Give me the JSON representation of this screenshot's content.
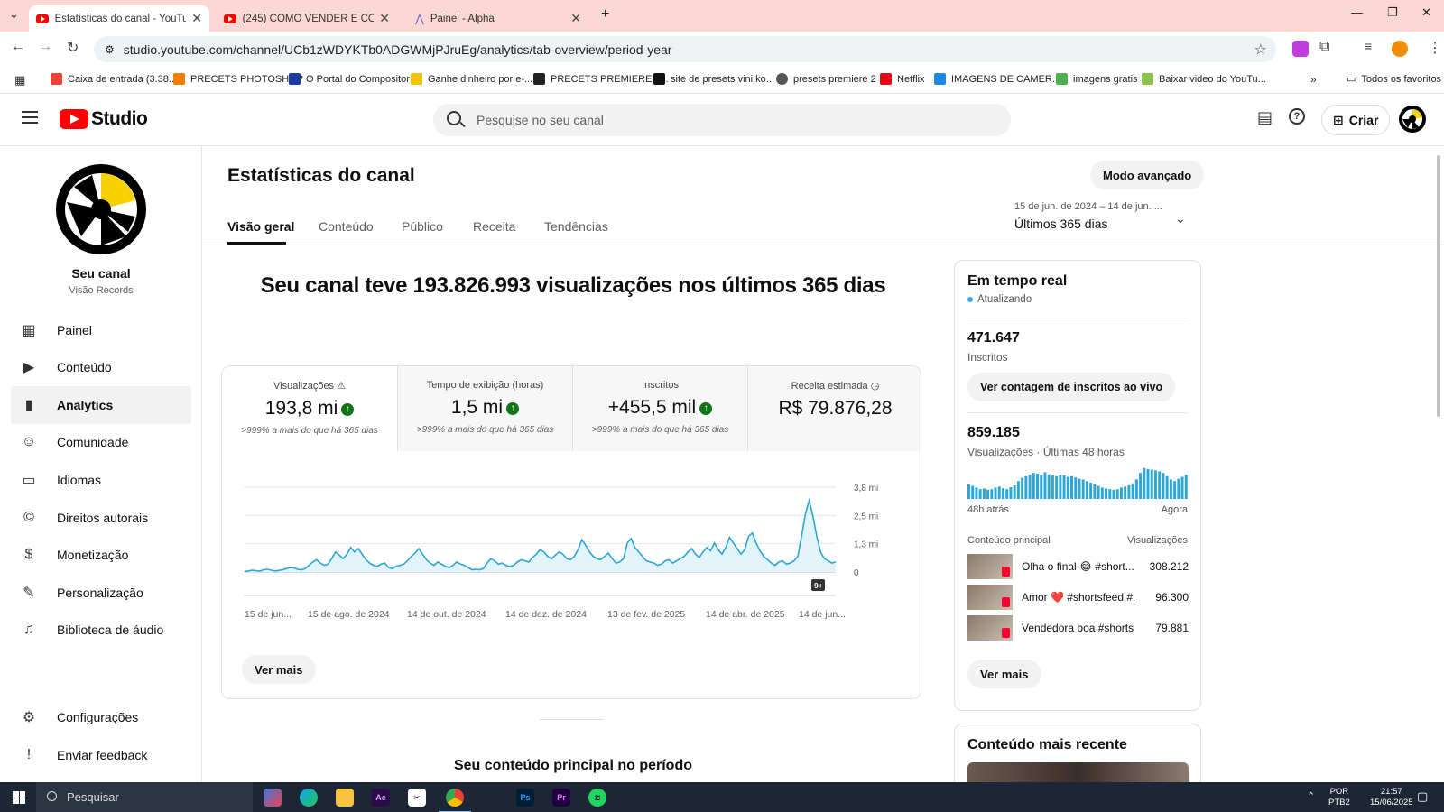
{
  "browser": {
    "tabs": [
      {
        "label": "Estatísticas do canal - YouTube Studio",
        "active": true
      },
      {
        "label": "(245) COMO VENDER E COMPRAR",
        "active": false
      },
      {
        "label": "Painel - Alpha",
        "active": false
      }
    ],
    "url": "studio.youtube.com/channel/UCb1zWDYKTb0ADGWMjPJruEg/analytics/tab-overview/period-year",
    "bookmarks": [
      {
        "label": "Caixa de entrada (3.38...",
        "color": "#ea4335"
      },
      {
        "label": "PRECETS PHOTOSHOP",
        "color": "#f57c00"
      },
      {
        "label": "O Portal do Compositor",
        "color": "#1a3c9e"
      },
      {
        "label": "Ganhe dinheiro por e-...",
        "color": "#f4c20d"
      },
      {
        "label": "PRECETS PREMIERE P...",
        "color": "#222222"
      },
      {
        "label": "site de presets vini ko...",
        "color": "#111111"
      },
      {
        "label": "presets premiere 2",
        "color": "#555555"
      },
      {
        "label": "Netflix",
        "color": "#e50914"
      },
      {
        "label": "IMAGENS DE CAMER...",
        "color": "#1e88e5"
      },
      {
        "label": "imagens gratis",
        "color": "#4caf50"
      },
      {
        "label": "Baixar video do YouTu...",
        "color": "#8bc34a"
      }
    ],
    "bookmarks_all": "Todos os favoritos"
  },
  "header": {
    "logo_text": "Studio",
    "search_placeholder": "Pesquise no seu canal",
    "create_label": "Criar"
  },
  "sidebar": {
    "channel_name": "Seu canal",
    "channel_sub": "Visão Records",
    "items": [
      {
        "label": "Painel",
        "icon": "dashboard-icon",
        "glyph": "▦",
        "active": false
      },
      {
        "label": "Conteúdo",
        "icon": "content-icon",
        "glyph": "▶",
        "active": false
      },
      {
        "label": "Analytics",
        "icon": "analytics-icon",
        "glyph": "▮",
        "active": true
      },
      {
        "label": "Comunidade",
        "icon": "community-icon",
        "glyph": "☺",
        "active": false
      },
      {
        "label": "Idiomas",
        "icon": "subtitles-icon",
        "glyph": "▭",
        "active": false
      },
      {
        "label": "Direitos autorais",
        "icon": "copyright-icon",
        "glyph": "©",
        "active": false
      },
      {
        "label": "Monetização",
        "icon": "dollar-icon",
        "glyph": "$",
        "active": false
      },
      {
        "label": "Personalização",
        "icon": "magic-wand-icon",
        "glyph": "✎",
        "active": false
      },
      {
        "label": "Biblioteca de áudio",
        "icon": "audio-library-icon",
        "glyph": "♫",
        "active": false
      }
    ],
    "settings": "Configurações",
    "feedback": "Enviar feedback"
  },
  "main": {
    "title": "Estatísticas do canal",
    "advanced_mode": "Modo avançado",
    "date_range_small": "15 de jun. de 2024 – 14 de jun. ...",
    "date_range": "Últimos 365 dias",
    "tabs": [
      "Visão geral",
      "Conteúdo",
      "Público",
      "Receita",
      "Tendências"
    ],
    "headline": "Seu canal teve 193.826.993 visualizações nos últimos 365 dias",
    "metrics": [
      {
        "label": "Visualizações",
        "value": "193,8 mi",
        "delta": ">999% a mais do que há 365 dias",
        "up": true
      },
      {
        "label": "Tempo de exibição (horas)",
        "value": "1,5 mi",
        "delta": ">999% a mais do que há 365 dias",
        "up": true
      },
      {
        "label": "Inscritos",
        "value": "+455,5 mil",
        "delta": ">999% a mais do que há 365 dias",
        "up": true
      },
      {
        "label": "Receita estimada",
        "value": "R$ 79.876,28",
        "delta": "",
        "up": false
      }
    ],
    "see_more": "Ver mais",
    "section_title": "Seu conteúdo principal no período",
    "badge": "9+"
  },
  "chart_data": {
    "type": "line",
    "x_ticks": [
      "15 de jun...",
      "15 de ago. de 2024",
      "14 de out. de 2024",
      "14 de dez. de 2024",
      "13 de fev. de 2025",
      "14 de abr. de 2025",
      "14 de jun..."
    ],
    "y_ticks": [
      "0",
      "1,3 mi",
      "2,5 mi",
      "3,8 mi"
    ],
    "ylim": [
      0,
      3.8
    ],
    "values": [
      0.02,
      0.05,
      0.08,
      0.06,
      0.04,
      0.1,
      0.12,
      0.08,
      0.05,
      0.07,
      0.1,
      0.15,
      0.2,
      0.18,
      0.12,
      0.1,
      0.15,
      0.3,
      0.45,
      0.55,
      0.4,
      0.3,
      0.35,
      0.6,
      0.9,
      0.75,
      0.6,
      0.8,
      1.1,
      0.9,
      1.05,
      0.8,
      0.55,
      0.4,
      0.3,
      0.25,
      0.35,
      0.4,
      0.2,
      0.15,
      0.25,
      0.3,
      0.35,
      0.5,
      0.7,
      0.85,
      1.05,
      0.8,
      0.55,
      0.4,
      0.3,
      0.45,
      0.35,
      0.25,
      0.2,
      0.3,
      0.45,
      0.35,
      0.3,
      0.2,
      0.1,
      0.12,
      0.1,
      0.15,
      0.4,
      0.6,
      0.5,
      0.35,
      0.4,
      0.3,
      0.25,
      0.3,
      0.45,
      0.55,
      0.5,
      0.45,
      0.65,
      0.8,
      1.0,
      0.9,
      0.7,
      0.6,
      0.75,
      0.9,
      0.8,
      0.6,
      0.55,
      0.7,
      1.0,
      1.45,
      1.2,
      0.9,
      0.7,
      0.6,
      0.55,
      0.7,
      0.85,
      0.6,
      0.4,
      0.45,
      0.6,
      1.3,
      1.5,
      1.1,
      0.9,
      0.7,
      0.5,
      0.45,
      0.4,
      0.3,
      0.35,
      0.5,
      0.55,
      0.4,
      0.5,
      0.6,
      0.7,
      0.9,
      1.05,
      0.8,
      0.65,
      0.9,
      1.1,
      0.95,
      1.3,
      1.0,
      0.8,
      1.1,
      1.55,
      1.3,
      1.05,
      0.8,
      1.0,
      1.6,
      1.75,
      1.3,
      0.95,
      0.7,
      0.55,
      0.4,
      0.3,
      0.45,
      0.5,
      0.35,
      0.4,
      0.5,
      0.7,
      1.6,
      2.6,
      3.2,
      2.5,
      1.6,
      0.9,
      0.6,
      0.5,
      0.4,
      0.45
    ],
    "title": "",
    "xlabel": "",
    "ylabel": ""
  },
  "realtime": {
    "title": "Em tempo real",
    "status": "Atualizando",
    "subscribers": "471.647",
    "subscribers_label": "Inscritos",
    "live_count_btn": "Ver contagem de inscritos ao vivo",
    "views": "859.185",
    "views_label": "Visualizações · Últimas 48 horas",
    "left_label": "48h atrás",
    "right_label": "Agora",
    "content_header": "Conteúdo principal",
    "views_header": "Visualizações",
    "items": [
      {
        "title": "Olha o final 😂 #short...",
        "views": "308.212"
      },
      {
        "title": "Amor ❤️ #shortsfeed #...",
        "views": "96.300"
      },
      {
        "title": "Vendedora boa #shorts...",
        "views": "79.881"
      }
    ],
    "see_more": "Ver mais",
    "bars": [
      45,
      40,
      35,
      30,
      32,
      28,
      30,
      35,
      38,
      33,
      30,
      36,
      42,
      55,
      65,
      70,
      75,
      80,
      78,
      74,
      82,
      76,
      72,
      70,
      75,
      73,
      68,
      70,
      66,
      62,
      60,
      55,
      50,
      45,
      40,
      35,
      32,
      30,
      28,
      30,
      35,
      38,
      42,
      48,
      60,
      80,
      95,
      92,
      90,
      88,
      85,
      80,
      70,
      60,
      55,
      62,
      68,
      74
    ]
  },
  "recent": {
    "title": "Conteúdo mais recente"
  },
  "taskbar": {
    "search": "Pesquisar",
    "lang1": "POR",
    "lang2": "PTB2",
    "time": "21:57",
    "date": "15/06/2025"
  }
}
